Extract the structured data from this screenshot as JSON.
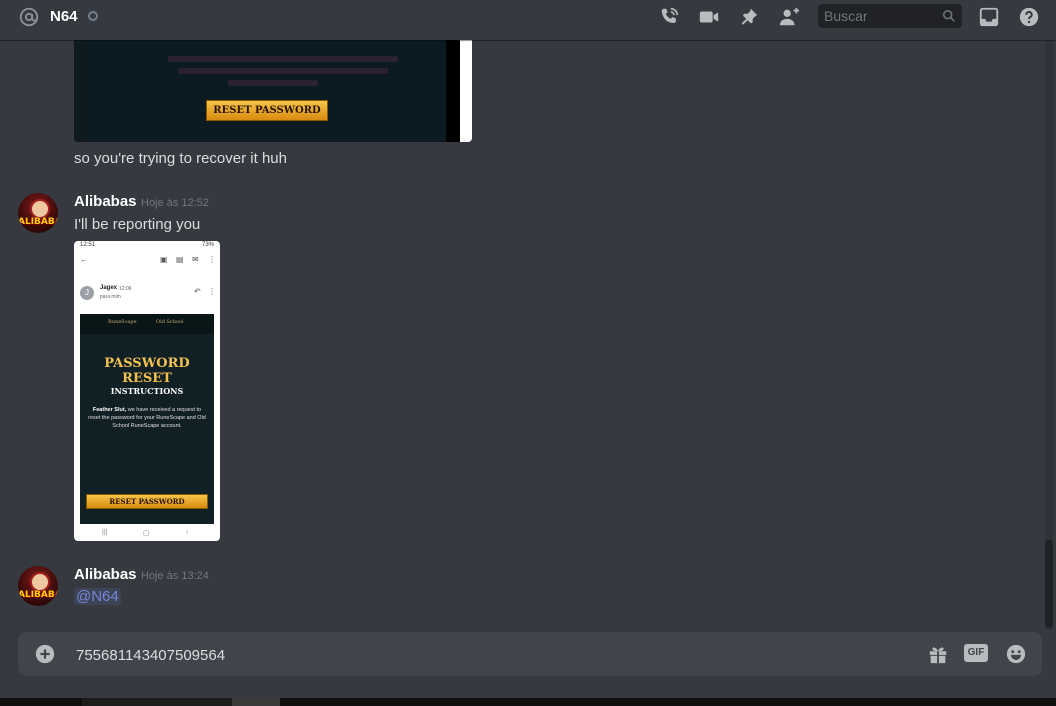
{
  "header": {
    "channel_name": "N64",
    "search_placeholder": "Buscar"
  },
  "messages": [
    {
      "continuation_text": "so you're trying to recover it huh",
      "image_button_label": "RESET PASSWORD"
    },
    {
      "author": "Alibabas",
      "timestamp": "Hoje às 12:52",
      "text": "I'll be reporting you",
      "avatar_text": "ALIBABA'S",
      "attachment": {
        "status_time": "12:51",
        "status_battery": "73%",
        "sender_initial": "J",
        "sender_name": "Jagex",
        "sender_time": "12:06",
        "sender_to": "para mim",
        "logo_left": "RuneScape",
        "logo_right": "Old School",
        "title_line1": "PASSWORD",
        "title_line2": "RESET",
        "subtitle": "INSTRUCTIONS",
        "desc_name": "Feather Slut,",
        "desc_rest": " we have received a request to reset the password for your RuneScape and Old School RuneScape account.",
        "button_label": "RESET PASSWORD"
      }
    },
    {
      "author": "Alibabas",
      "timestamp": "Hoje às 13:24",
      "mention": "@N64",
      "avatar_text": "ALIBABA'S"
    }
  ],
  "input": {
    "value": "755681143407509564",
    "gif_label": "GIF"
  },
  "colors": {
    "background": "#36393f",
    "input_bg": "#40444b",
    "mention": "#7289da",
    "reset_button": "#f2a51e"
  },
  "icons": [
    "at-icon",
    "status-icon",
    "phone-call-icon",
    "video-call-icon",
    "pin-icon",
    "add-member-icon",
    "search-icon",
    "inbox-icon",
    "help-icon",
    "add-attachment-icon",
    "gift-icon",
    "gif-icon",
    "emoji-icon"
  ]
}
